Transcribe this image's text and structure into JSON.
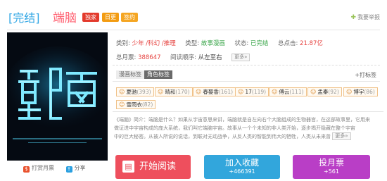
{
  "header": {
    "status_tag": "[完结]",
    "title": "端脑",
    "badges": [
      "独家",
      "日更",
      "签约"
    ],
    "report_label": "我要举报"
  },
  "info": {
    "category_label": "类别:",
    "category_value": "少年 /科幻 /推理",
    "type_label": "类型:",
    "type_value": "故事漫画",
    "status_label": "状态:",
    "status_value": "已完结",
    "clicks_label": "总点击:",
    "clicks_value": "21.87亿",
    "monthly_label": "总月票:",
    "monthly_value": "388647",
    "order_label": "阅读顺序:",
    "order_value": "从左至右",
    "more_label": "更多»",
    "more_label2": "更多»"
  },
  "tabs": [
    {
      "label": "漫画标签"
    },
    {
      "label": "角色标签"
    }
  ],
  "tag_button": "+打标签",
  "chips": [
    {
      "name": "夏驰",
      "count": "(393)"
    },
    {
      "name": "晴和",
      "count": "(170)"
    },
    {
      "name": "春娶香",
      "count": "(161)"
    },
    {
      "name": "17",
      "count": "(119)"
    },
    {
      "name": "傅云",
      "count": "(111)"
    },
    {
      "name": "孟秦",
      "count": "(92)"
    },
    {
      "name": "博宇",
      "count": "(86)"
    },
    {
      "name": "雪雨衣",
      "count": "(82)"
    }
  ],
  "intro": {
    "line1": "《端脑》简介：端脑是什么？如果从宇宙意思来讲，端脑就是自左向右个大脑组成的生物器官，在这部故事里，它用来",
    "line2": "做证进中宇宙构成的庞大系统，我们叫它端脑宇宙。故事从一个个未知的非人类开始，逐步揭开隐藏在整个宇宙",
    "line3": "中的巨大秘密。从被人所说的说话，到联对无动战争，从反人类的智能到伟大的牺牲，人类从未来曾"
  },
  "cover": {
    "text": "端脑"
  },
  "cover_actions": {
    "vote": "打赏月票",
    "share": "分享"
  },
  "buttons": {
    "read": "开始阅读",
    "fav_main": "加入收藏",
    "fav_sub": "+466391",
    "vote_main": "投月票",
    "vote_sub": "+561"
  }
}
